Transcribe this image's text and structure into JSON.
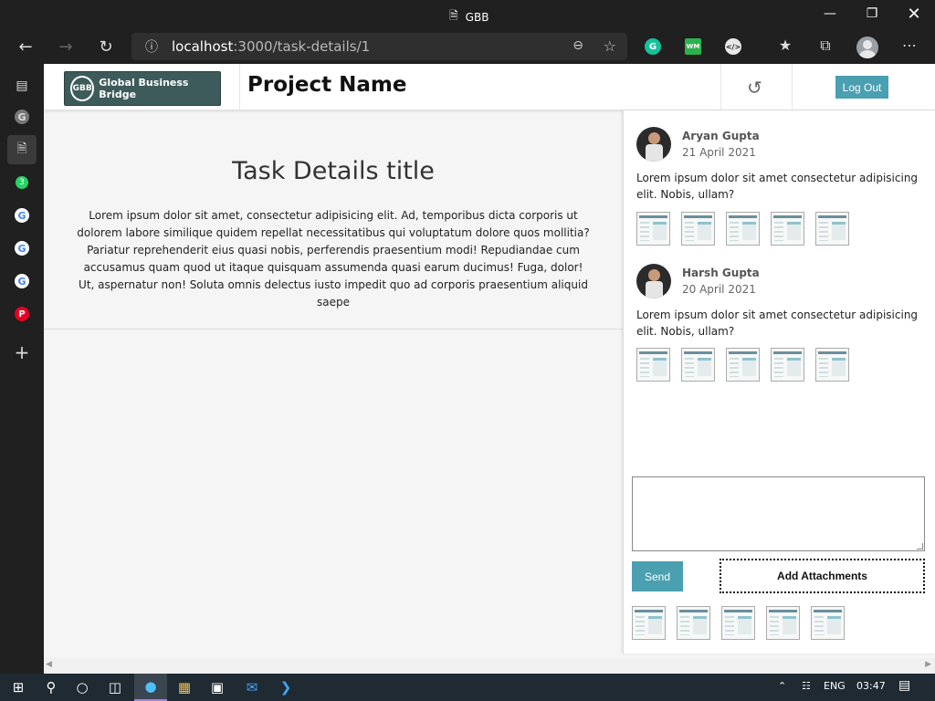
{
  "window": {
    "title": "GBB"
  },
  "browser": {
    "url_host": "localhost",
    "url_path": ":3000/task-details/1",
    "extensions": [
      "grammarly-icon",
      "wm-extension-icon",
      "devtools-extension-icon"
    ]
  },
  "sidebar": {
    "items": [
      "tabs-icon",
      "google-icon",
      "page-icon",
      "whatsapp-icon",
      "google-icon",
      "google-icon",
      "google-icon",
      "pinterest-icon",
      "add-icon"
    ]
  },
  "header": {
    "logo_mark": "GBB",
    "logo_text": "Global Business Bridge",
    "project_name": "Project Name",
    "logout_label": "Log Out"
  },
  "task": {
    "title": "Task Details title",
    "body": "Lorem ipsum dolor sit amet, consectetur adipisicing elit. Ad, temporibus dicta corporis ut dolorem labore similique quidem repellat necessitatibus qui voluptatum dolore quos mollitia? Pariatur reprehenderit eius quasi nobis, perferendis praesentium modi! Repudiandae cum accusamus quam quod ut itaque quisquam assumenda quasi earum ducimus! Fuga, dolor! Ut, aspernatur non! Soluta omnis delectus iusto impedit quo ad corporis praesentium aliquid saepe"
  },
  "comments": [
    {
      "name": "Aryan Gupta",
      "date": "21 April 2021",
      "text": "Lorem ipsum dolor sit amet consectetur adipisicing elit. Nobis, ullam?",
      "attachments": 5
    },
    {
      "name": "Harsh Gupta",
      "date": "20 April 2021",
      "text": "Lorem ipsum dolor sit amet consectetur adipisicing elit. Nobis, ullam?",
      "attachments": 5
    }
  ],
  "composer": {
    "value": "",
    "send_label": "Send",
    "add_attachments_label": "Add Attachments",
    "attachments": 5
  },
  "taskbar": {
    "language": "ENG",
    "time": "03:47"
  },
  "colors": {
    "accent": "#4a9fb0",
    "logo_bg": "#3d5b5a",
    "chrome_bg": "#202020",
    "taskbar_bg": "#1f2a33"
  }
}
